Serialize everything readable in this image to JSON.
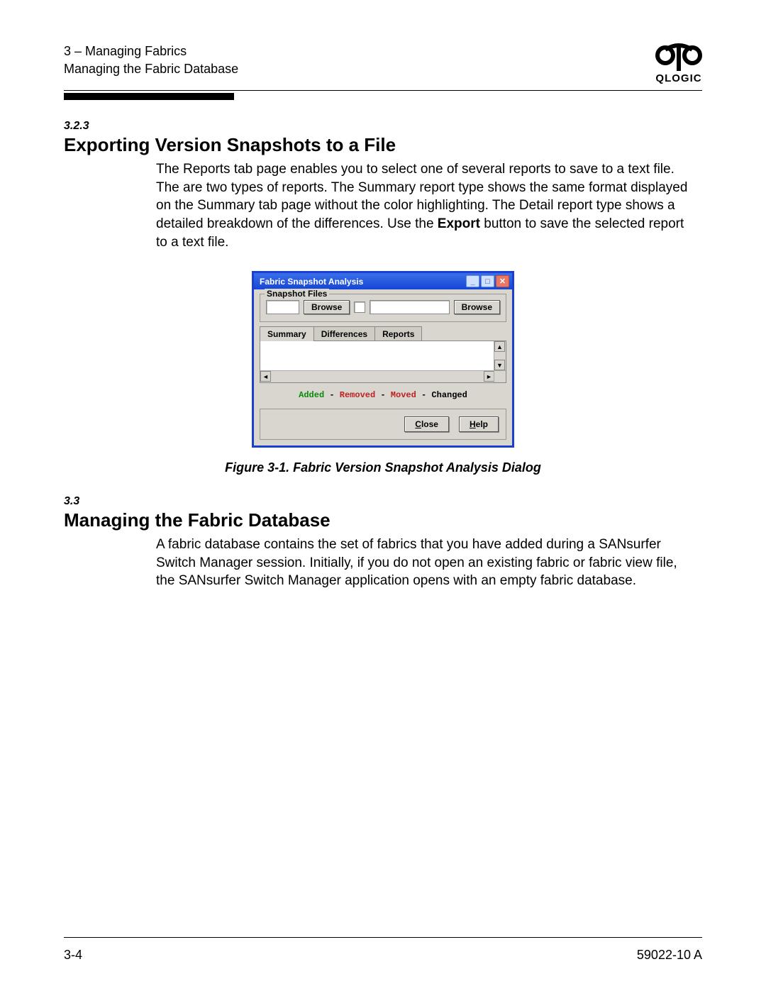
{
  "header": {
    "chapter": "3 – Managing Fabrics",
    "section": "Managing the Fabric Database",
    "logo_text": "QLOGIC"
  },
  "sec1": {
    "num": "3.2.3",
    "title": "Exporting Version Snapshots to a File",
    "para_a": "The Reports tab page enables you to select one of several reports to save to a text file. The are two types of reports. The Summary report type shows the same format displayed on the Summary tab page without the color highlighting. The Detail report type shows a detailed breakdown of the differences. Use the ",
    "export_word": "Export",
    "para_b": " button to save the selected report to a text file."
  },
  "dialog": {
    "title": "Fabric Snapshot Analysis",
    "fieldset_legend": "Snapshot Files",
    "browse": "Browse",
    "tabs": {
      "summary": "Summary",
      "differences": "Differences",
      "reports": "Reports"
    },
    "legend": {
      "added": "Added",
      "removed": "Removed",
      "moved": "Moved",
      "changed": "Changed",
      "sep": " - "
    },
    "close": "Close",
    "help": "Help"
  },
  "caption": "Figure 3-1.  Fabric Version Snapshot Analysis Dialog",
  "sec2": {
    "num": "3.3",
    "title": "Managing the Fabric Database",
    "para": "A fabric database contains the set of fabrics that you have added during a SANsurfer Switch Manager session. Initially, if you do not open an existing fabric or fabric view file, the SANsurfer Switch Manager application opens with an empty fabric database."
  },
  "footer": {
    "page": "3-4",
    "doc": "59022-10  A"
  }
}
